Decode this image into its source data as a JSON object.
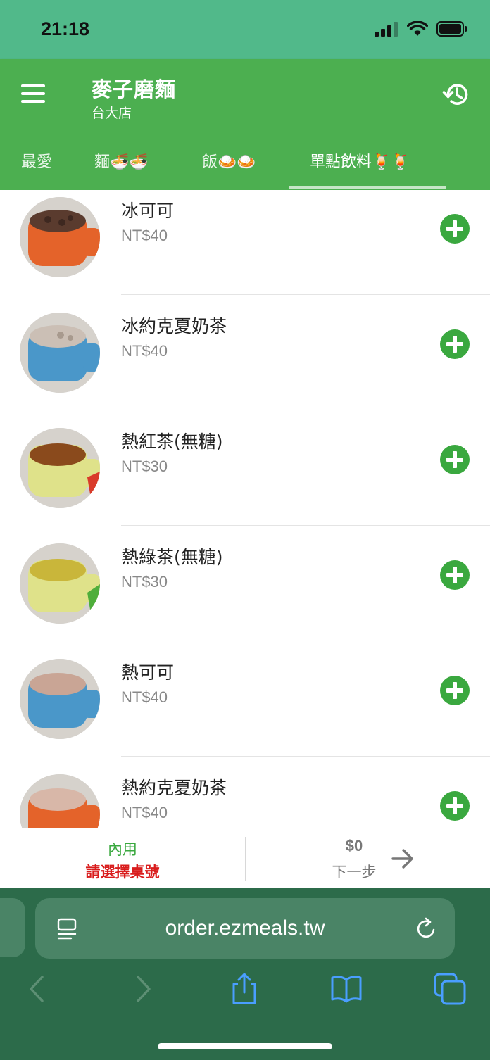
{
  "status_bar": {
    "time": "21:18"
  },
  "header": {
    "title": "麥子磨麵",
    "subtitle": "台大店"
  },
  "tabs": [
    {
      "label": "最愛"
    },
    {
      "label": "麵🍜🍜"
    },
    {
      "label": "飯🍛🍛"
    },
    {
      "label": "單點飲料🍹🍹",
      "active": true
    }
  ],
  "items": [
    {
      "name": "冰可可",
      "price": "NT$40",
      "drink_color": "#5a3b2e",
      "cup_color": "#e4632a"
    },
    {
      "name": "冰約克夏奶茶",
      "price": "NT$40",
      "drink_color": "#cbbfb5",
      "cup_color": "#4a97c9"
    },
    {
      "name": "熱紅茶(無糖)",
      "price": "NT$30",
      "drink_color": "#8a4a1c",
      "cup_color": "#dfe28a"
    },
    {
      "name": "熱綠茶(無糖)",
      "price": "NT$30",
      "drink_color": "#c9b63a",
      "cup_color": "#dfe28a"
    },
    {
      "name": "熱可可",
      "price": "NT$40",
      "drink_color": "#c9a595",
      "cup_color": "#4a97c9"
    },
    {
      "name": "熱約克夏奶茶",
      "price": "NT$40",
      "drink_color": "#d8b7a8",
      "cup_color": "#e4632a"
    }
  ],
  "order_bar": {
    "dine_type": "內用",
    "table_prompt": "請選擇桌號",
    "total": "$0",
    "next_label": "下一步"
  },
  "browser": {
    "url": "order.ezmeals.tw"
  },
  "colors": {
    "brand_green": "#4caf50",
    "status_green": "#51b98a",
    "add_green": "#3aa83f",
    "alert_red": "#d91c1c"
  }
}
